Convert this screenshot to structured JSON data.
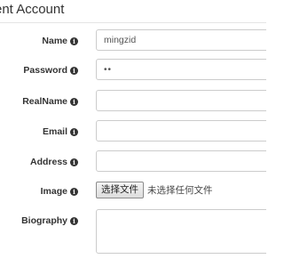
{
  "form": {
    "title": "ent Account",
    "fields": [
      {
        "label": "Name",
        "value": "mingzid"
      },
      {
        "label": "Password",
        "value": "••"
      },
      {
        "label": "RealName",
        "value": ""
      },
      {
        "label": "Email",
        "value": ""
      },
      {
        "label": "Address",
        "value": ""
      },
      {
        "label": "Image",
        "button_label": "选择文件",
        "status": "未选择任何文件"
      },
      {
        "label": "Biography",
        "value": ""
      }
    ]
  },
  "icons": {
    "field_info": "info-circle-icon"
  }
}
